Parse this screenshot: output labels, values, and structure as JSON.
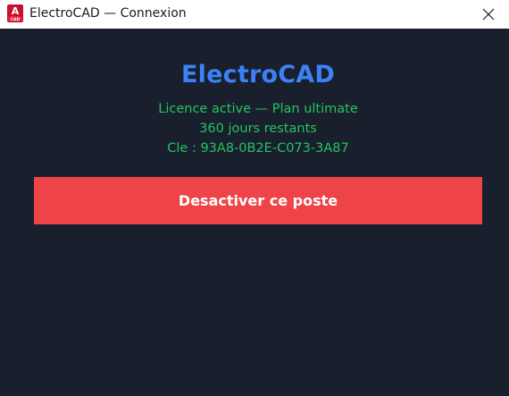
{
  "window": {
    "title": "ElectroCAD — Connexion",
    "app_icon": "autocad-app-icon",
    "app_icon_letter": "A",
    "app_icon_sublabel": "CAD",
    "close_icon": "close-icon"
  },
  "license": {
    "brand": "ElectroCAD",
    "status": "Licence active — Plan ultimate",
    "days_remaining": "360 jours restants",
    "key": "Cle : 93A8-0B2E-C073-3A87"
  },
  "actions": {
    "deactivate_label": "Desactiver ce poste"
  },
  "colors": {
    "background": "#1a1f2e",
    "brand": "#3b82f6",
    "status_text": "#22c55e",
    "danger_button": "#ef4447"
  }
}
